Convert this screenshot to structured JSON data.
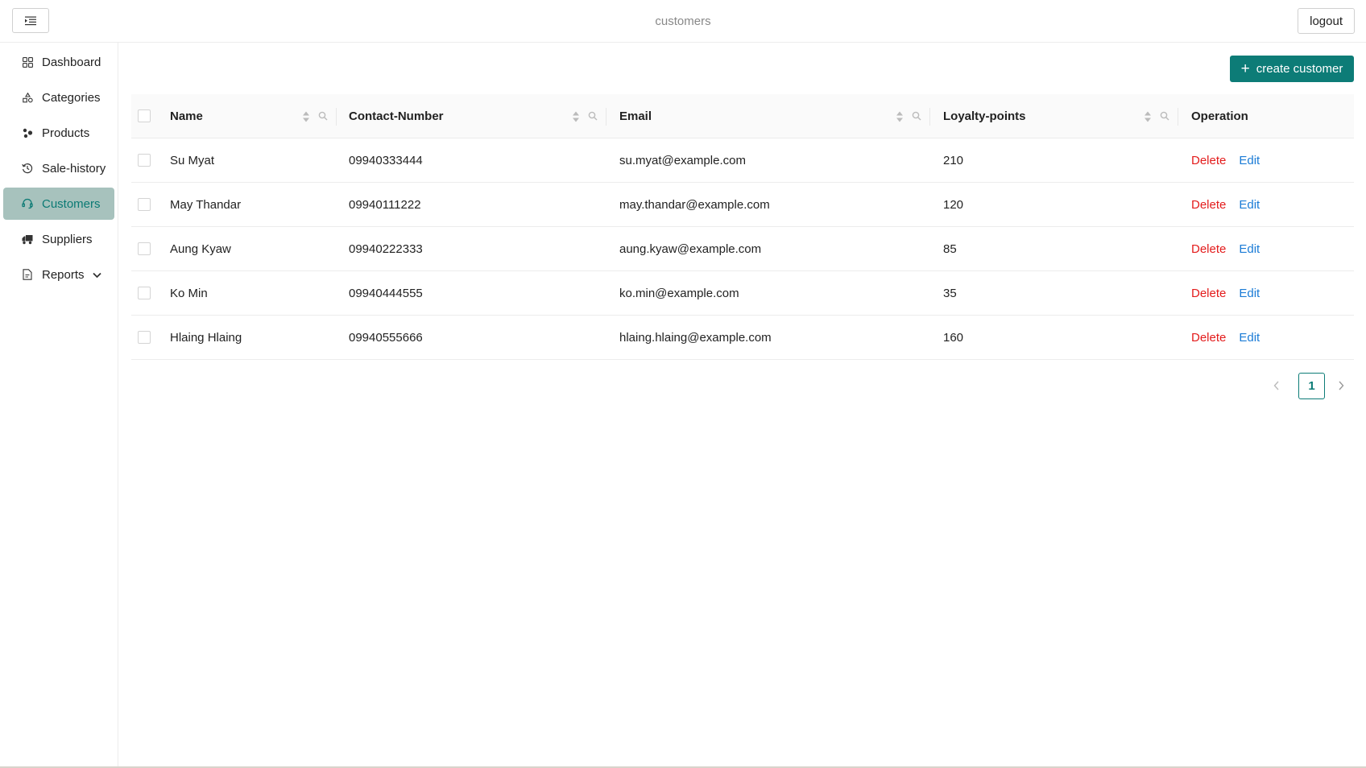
{
  "header": {
    "title": "customers",
    "logout_label": "logout",
    "menu_icon": "menu-fold-icon"
  },
  "sidebar": {
    "items": [
      {
        "label": "Dashboard",
        "icon": "dashboard-grid-icon",
        "active": false
      },
      {
        "label": "Categories",
        "icon": "shapes-icon",
        "active": false
      },
      {
        "label": "Products",
        "icon": "products-icon",
        "active": false
      },
      {
        "label": "Sale-history",
        "icon": "history-icon",
        "active": false
      },
      {
        "label": "Customers",
        "icon": "customer-service-icon",
        "active": true
      },
      {
        "label": "Suppliers",
        "icon": "truck-icon",
        "active": false
      },
      {
        "label": "Reports",
        "icon": "file-report-icon",
        "active": false,
        "expandable": true
      }
    ]
  },
  "toolbar": {
    "create_label": "create customer"
  },
  "table": {
    "columns": [
      "Name",
      "Contact-Number",
      "Email",
      "Loyalty-points",
      "Operation"
    ],
    "rows": [
      {
        "name": "Su Myat",
        "contact": "09940333444",
        "email": "su.myat@example.com",
        "points": "210"
      },
      {
        "name": "May Thandar",
        "contact": "09940111222",
        "email": "may.thandar@example.com",
        "points": "120"
      },
      {
        "name": "Aung Kyaw",
        "contact": "09940222333",
        "email": "aung.kyaw@example.com",
        "points": "85"
      },
      {
        "name": "Ko Min",
        "contact": "09940444555",
        "email": "ko.min@example.com",
        "points": "35"
      },
      {
        "name": "Hlaing Hlaing",
        "contact": "09940555666",
        "email": "hlaing.hlaing@example.com",
        "points": "160"
      }
    ],
    "actions": {
      "delete": "Delete",
      "edit": "Edit"
    }
  },
  "pagination": {
    "current_page": "1"
  },
  "colors": {
    "accent": "#0d7c77",
    "active_nav_bg": "#a7c2bd",
    "delete": "#e31b1b",
    "edit": "#1a7bd6"
  }
}
